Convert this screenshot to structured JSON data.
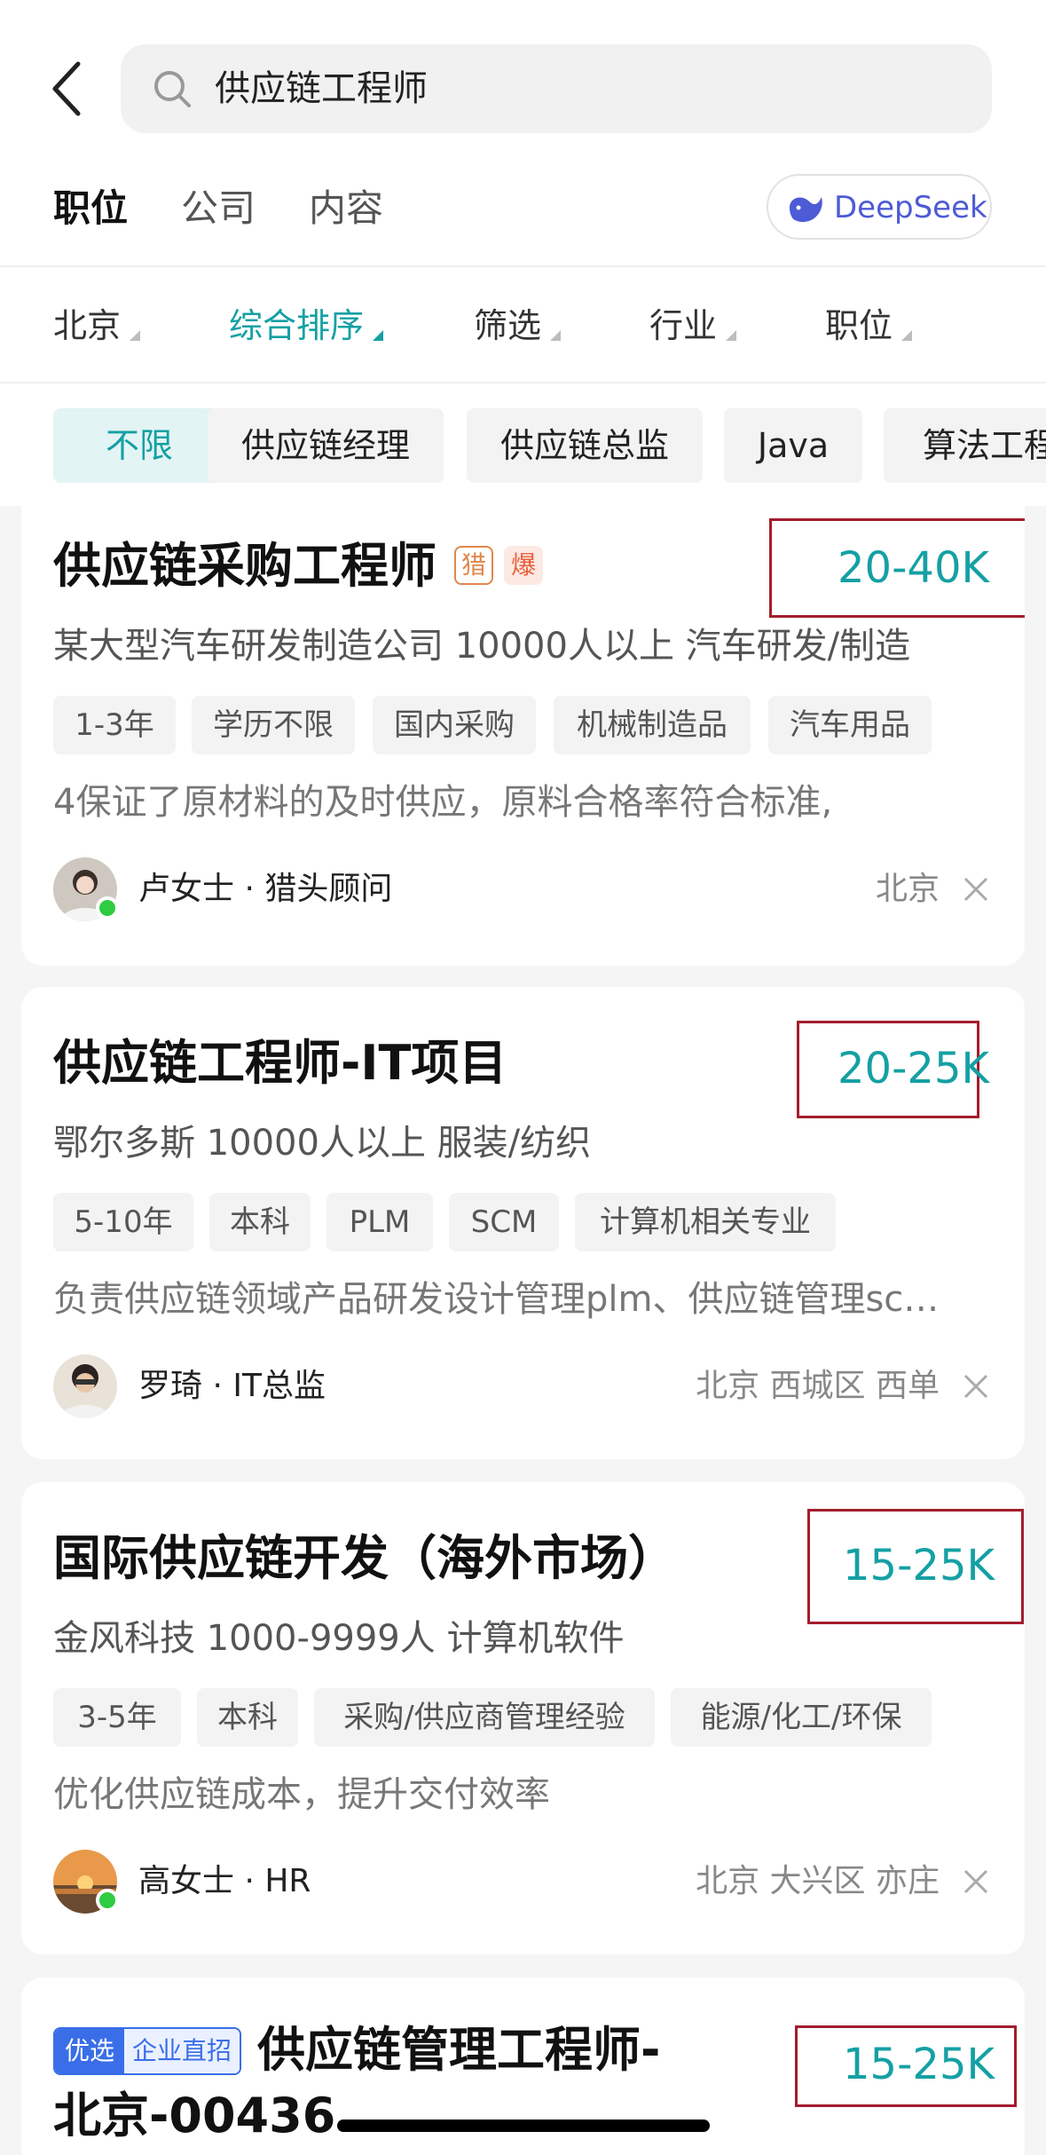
{
  "search": {
    "query": "供应链工程师"
  },
  "tabs": [
    {
      "label": "职位",
      "active": true
    },
    {
      "label": "公司",
      "active": false
    },
    {
      "label": "内容",
      "active": false
    }
  ],
  "deepseek": {
    "label": "DeepSeek"
  },
  "filters": [
    {
      "label": "北京",
      "active": false
    },
    {
      "label": "综合排序",
      "active": true
    },
    {
      "label": "筛选",
      "active": false
    },
    {
      "label": "行业",
      "active": false
    },
    {
      "label": "职位",
      "active": false
    }
  ],
  "chips": [
    "不限",
    "供应链经理",
    "供应链总监",
    "Java",
    "算法工程"
  ],
  "accent_color": "#15a0a4",
  "jobs": [
    {
      "title": "供应链采购工程师",
      "badge_hunter": "猎",
      "badge_hot": "爆",
      "salary": "20-40K",
      "company": "某大型汽车研发制造公司 10000人以上 汽车研发/制造",
      "tags": [
        "1-3年",
        "学历不限",
        "国内采购",
        "机械制造品",
        "汽车用品"
      ],
      "desc": "4保证了原材料的及时供应，原料合格率符合标准,",
      "recruiter": "卢女士 · 猎头顾问",
      "location": "北京"
    },
    {
      "title": "供应链工程师-IT项目",
      "salary": "20-25K",
      "company": "鄂尔多斯 10000人以上 服装/纺织",
      "tags": [
        "5-10年",
        "本科",
        "PLM",
        "SCM",
        "计算机相关专业"
      ],
      "desc": "负责供应链领域产品研发设计管理plm、供应链管理sc…",
      "recruiter": "罗琦 · IT总监",
      "location": "北京 西城区 西单"
    },
    {
      "title": "国际供应链开发（海外市场）",
      "salary": "15-25K",
      "company": "金风科技 1000-9999人 计算机软件",
      "tags": [
        "3-5年",
        "本科",
        "采购/供应商管理经验",
        "能源/化工/环保"
      ],
      "desc": "优化供应链成本，提升交付效率",
      "recruiter": "高女士 · HR",
      "location": "北京 大兴区 亦庄"
    },
    {
      "badge_a": "优选",
      "badge_b": "企业直招",
      "title_line1": "供应链管理工程师-",
      "title_line2": "北京-00436",
      "salary": "15-25K"
    }
  ]
}
